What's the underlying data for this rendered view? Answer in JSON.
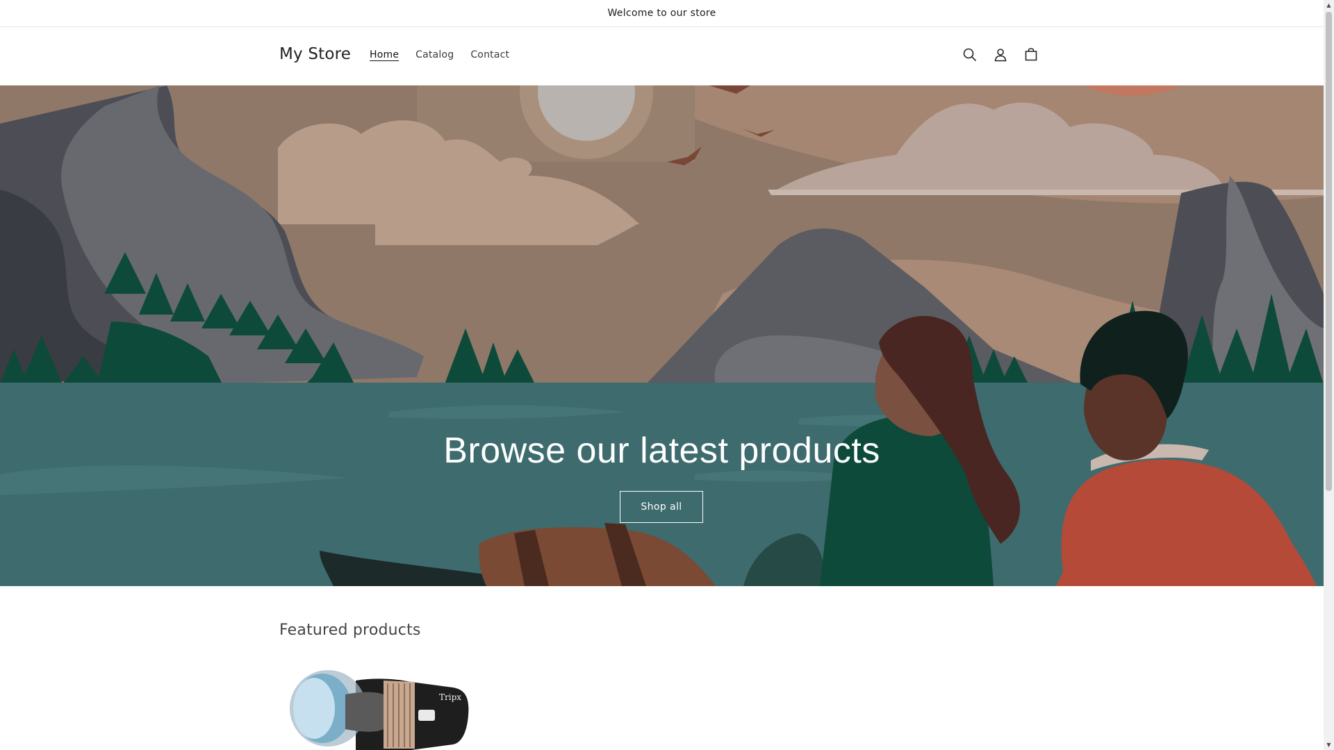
{
  "announcement": {
    "text": "Welcome to our store"
  },
  "header": {
    "store_name": "My Store",
    "nav": [
      {
        "label": "Home",
        "active": true
      },
      {
        "label": "Catalog",
        "active": false
      },
      {
        "label": "Contact",
        "active": false
      }
    ],
    "icons": [
      "search-icon",
      "account-icon",
      "cart-icon"
    ]
  },
  "hero": {
    "title": "Browse our latest products",
    "button_label": "Shop all"
  },
  "featured": {
    "title": "Featured products"
  },
  "colors": {
    "sky": "#8f7a6a",
    "water": "#3e6b6e",
    "forest": "#0d4a3a",
    "mountain": "#5a5c61"
  }
}
